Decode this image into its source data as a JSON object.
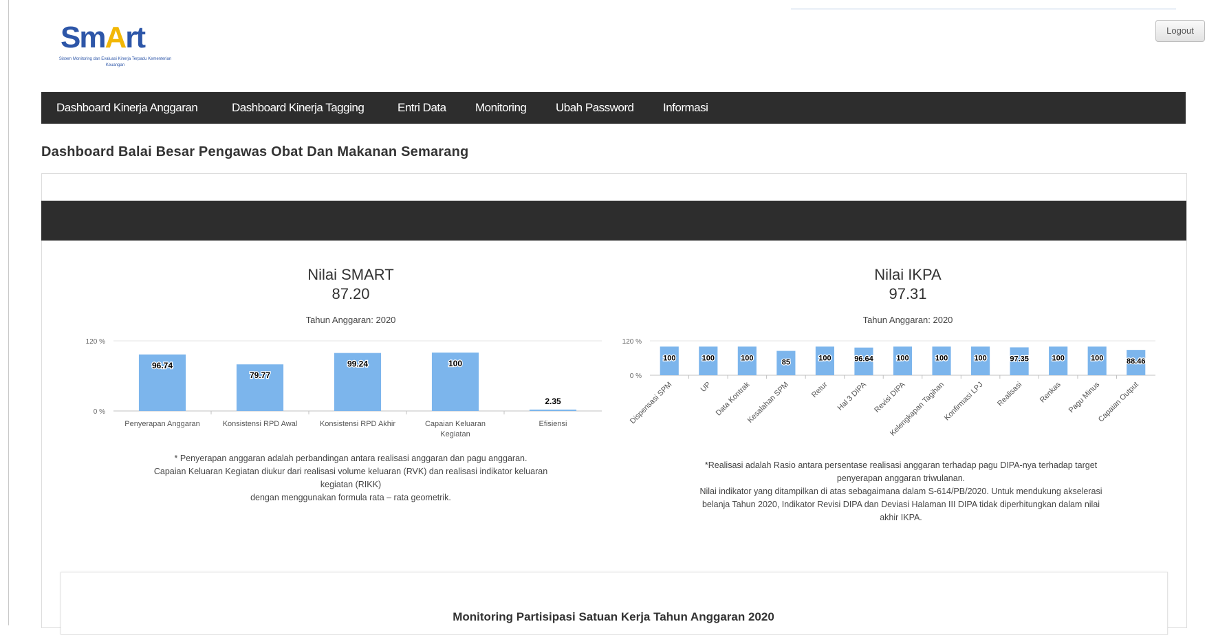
{
  "logo": {
    "brand": "SmArt",
    "brand_a": "Sm",
    "brand_star": "A",
    "brand_b": "rt",
    "subtitle": "Sistem Monitoring dan Evaluasi Kinerja Terpadu Kementerian Keuangan"
  },
  "header": {
    "logout_label": "Logout"
  },
  "nav": {
    "items": [
      "Dashboard Kinerja Anggaran",
      "Dashboard Kinerja Tagging",
      "Entri Data",
      "Monitoring",
      "Ubah Password",
      "Informasi"
    ]
  },
  "page": {
    "title": "Dashboard Balai Besar Pengawas Obat Dan Makanan Semarang"
  },
  "smart": {
    "title": "Nilai SMART",
    "score": "87.20",
    "subtitle": "Tahun Anggaran: 2020",
    "note": [
      "* Penyerapan anggaran adalah perbandingan antara realisasi anggaran dan pagu anggaran.",
      "Capaian Keluaran Kegiatan diukur dari realisasi volume keluaran (RVK) dan realisasi indikator keluaran",
      "kegiatan (RIKK)",
      "dengan menggunakan formula rata – rata geometrik."
    ]
  },
  "ikpa": {
    "title": "Nilai IKPA",
    "score": "97.31",
    "subtitle": "Tahun Anggaran: 2020",
    "note": [
      "*Realisasi adalah Rasio antara persentase realisasi anggaran terhadap pagu DIPA-nya terhadap target",
      "penyerapan anggaran triwulanan.",
      "Nilai indikator yang ditampilkan di atas sebagaimana dalam S-614/PB/2020. Untuk mendukung akselerasi",
      "belanja Tahun 2020, Indikator Revisi DIPA dan Deviasi Halaman III DIPA tidak diperhitungkan dalam nilai",
      "akhir IKPA."
    ]
  },
  "chart_data": [
    {
      "type": "bar",
      "categories": [
        "Penyerapan Anggaran",
        "Konsistensi RPD Awal",
        "Konsistensi RPD Akhir",
        "Capaian Keluaran Kegiatan",
        "Efisiensi"
      ],
      "values": [
        96.74,
        79.77,
        99.24,
        100,
        2.35
      ],
      "value_labels": [
        "96.74",
        "79.77",
        "99.24",
        "100",
        "2.35"
      ],
      "y_ticks": [
        "120 %",
        "0 %"
      ],
      "ylim": [
        0,
        120
      ],
      "bar_color": "#7cb5ec"
    },
    {
      "type": "bar",
      "categories": [
        "Dispensasi SPM",
        "UP",
        "Data Kontrak",
        "Kesalahan SPM",
        "Retur",
        "Hal 3 DIPA",
        "Revisi DIPA",
        "Kelengkapan Tagihan",
        "Konfirmasi LPJ",
        "Realisasi",
        "Renkas",
        "Pagu Minus",
        "Capaian Output"
      ],
      "values": [
        100,
        100,
        100,
        85,
        100,
        96.64,
        100,
        100,
        100,
        97.35,
        100,
        100,
        88.46
      ],
      "value_labels": [
        "100",
        "100",
        "100",
        "85",
        "100",
        "96.64",
        "100",
        "100",
        "100",
        "97.35",
        "100",
        "100",
        "88.46"
      ],
      "y_ticks": [
        "120 %",
        "0 %"
      ],
      "ylim": [
        0,
        120
      ],
      "bar_color": "#7cb5ec"
    }
  ],
  "monitoring": {
    "title": "Monitoring Partisipasi Satuan Kerja Tahun Anggaran 2020"
  }
}
